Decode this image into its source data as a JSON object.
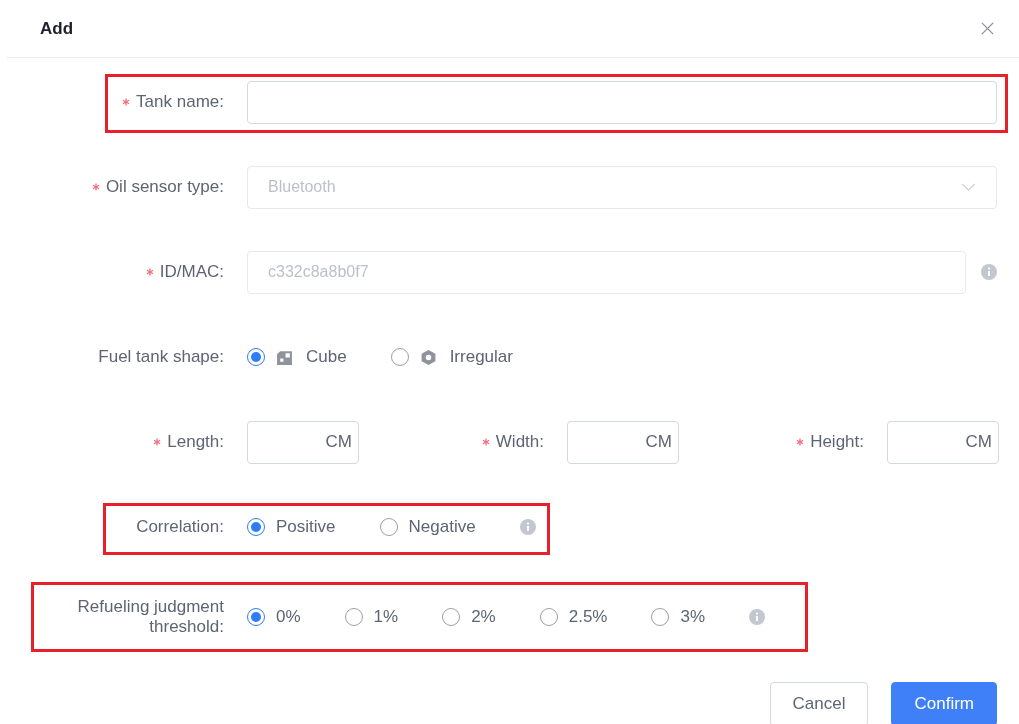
{
  "dialog": {
    "title": "Add"
  },
  "fields": [
    {
      "kind": "text",
      "label": "Tank name:",
      "required": true,
      "highlighted": true,
      "disabled": false
    },
    {
      "kind": "select",
      "label": "Oil sensor type:",
      "required": true,
      "value": "Bluetooth",
      "disabled": true
    },
    {
      "kind": "text",
      "label": "ID/MAC:",
      "required": true,
      "value": "c332c8a8b0f7",
      "disabled": true,
      "info": true
    },
    {
      "kind": "radio",
      "label": "Fuel tank shape:",
      "required": false,
      "options": [
        {
          "label": "Cube",
          "icon": true,
          "selected": true
        },
        {
          "label": "Irregular",
          "icon": true,
          "selected": false
        }
      ]
    },
    {
      "kind": "dimensions",
      "items": [
        {
          "label": "Length:",
          "unit": "CM",
          "required": true
        },
        {
          "label": "Width:",
          "unit": "CM",
          "required": true
        },
        {
          "label": "Height:",
          "unit": "CM",
          "required": true
        }
      ]
    },
    {
      "kind": "radio",
      "label": "Correlation:",
      "required": false,
      "highlighted": true,
      "info": true,
      "options": [
        {
          "label": "Positive",
          "selected": true
        },
        {
          "label": "Negative",
          "selected": false
        }
      ]
    },
    {
      "kind": "radio",
      "label": "Refueling judgment threshold:",
      "required": false,
      "highlighted": true,
      "info": true,
      "options": [
        {
          "label": "0%",
          "selected": true
        },
        {
          "label": "1%",
          "selected": false
        },
        {
          "label": "2%",
          "selected": false
        },
        {
          "label": "2.5%",
          "selected": false
        },
        {
          "label": "3%",
          "selected": false
        }
      ]
    }
  ],
  "buttons": [
    {
      "kind": "secondary",
      "label": "Cancel"
    },
    {
      "kind": "primary",
      "label": "Confirm"
    }
  ]
}
